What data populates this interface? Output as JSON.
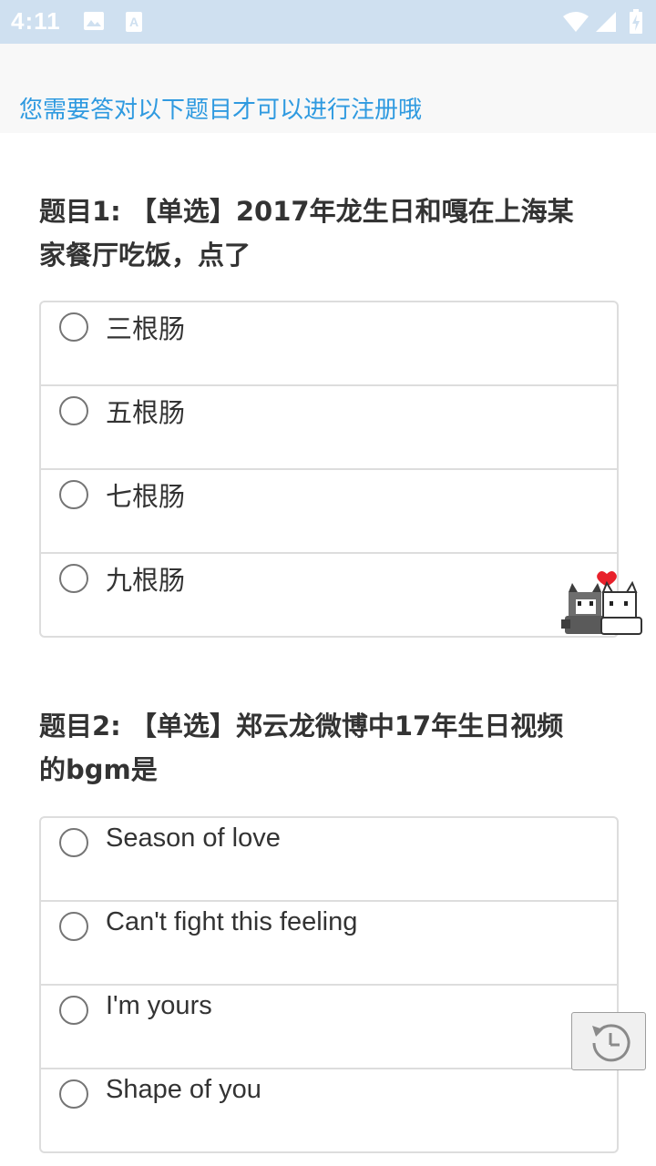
{
  "status_bar": {
    "time": "4:11",
    "icons": [
      "image-icon",
      "text-a-icon",
      "wifi-icon",
      "signal-icon",
      "battery-charging-icon"
    ]
  },
  "banner": {
    "notice": "您需要答对以下题目才可以进行注册哦",
    "color": "#2f9ae0"
  },
  "questions": [
    {
      "title_line1": "题目1: 【单选】2017年龙生日和嘎在上海某",
      "title_line2": "家餐厅吃饭，点了",
      "options": [
        "三根肠",
        "五根肠",
        "七根肠",
        "九根肠"
      ]
    },
    {
      "title_line1": "题目2: 【单选】郑云龙微博中17年生日视频",
      "title_line2": "的bgm是",
      "options": [
        "Season of love",
        "Can't fight this feeling",
        "I'm yours",
        "Shape of you"
      ]
    }
  ],
  "floating": {
    "pet_icon": "cat-pet-icon",
    "history_icon": "history-icon"
  }
}
